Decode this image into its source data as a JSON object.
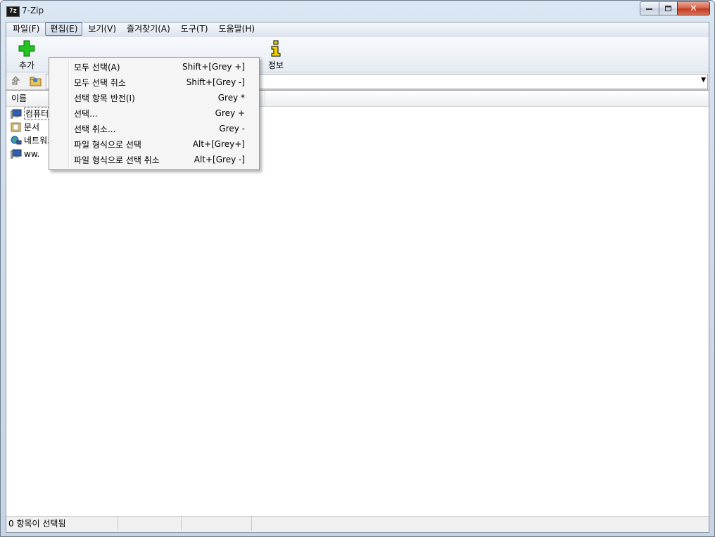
{
  "window": {
    "title": "7-Zip",
    "icon_text": "7z"
  },
  "caption": {
    "minimize": "—",
    "maximize": "□",
    "close": "✕"
  },
  "menu": [
    {
      "label": "파일(F)"
    },
    {
      "label": "편집(E)"
    },
    {
      "label": "보기(V)"
    },
    {
      "label": "즐겨찾기(A)"
    },
    {
      "label": "도구(T)"
    },
    {
      "label": "도움말(H)"
    }
  ],
  "toolbar": {
    "add_label": "추가",
    "info_label": "정보"
  },
  "list": {
    "column_name": "이름",
    "rows": [
      {
        "text": "컴퓨터",
        "icon": "computer-icon"
      },
      {
        "text": "문서",
        "icon": "documents-folder-icon"
      },
      {
        "text": "네트워크",
        "icon": "network-icon"
      },
      {
        "text": "ww.",
        "icon": "computer-icon"
      }
    ]
  },
  "edit_menu": [
    {
      "label": "모두 선택(A)",
      "shortcut": "Shift+[Grey +]"
    },
    {
      "label": "모두 선택 취소",
      "shortcut": "Shift+[Grey -]"
    },
    {
      "label": "선택 항목 반전(I)",
      "shortcut": "Grey *"
    },
    {
      "label": "선택...",
      "shortcut": "Grey +"
    },
    {
      "label": "선택 취소...",
      "shortcut": "Grey -"
    },
    {
      "label": "파일 형식으로 선택",
      "shortcut": "Alt+[Grey+]"
    },
    {
      "label": "파일 형식으로 선택 취소",
      "shortcut": "Alt+[Grey -]"
    }
  ],
  "status": {
    "selected": "0 항목이 선택됨",
    "cell2": "",
    "cell3": "",
    "cell4": ""
  },
  "colors": {
    "add_green": "#22c322",
    "info_yellow": "#f2d100"
  }
}
